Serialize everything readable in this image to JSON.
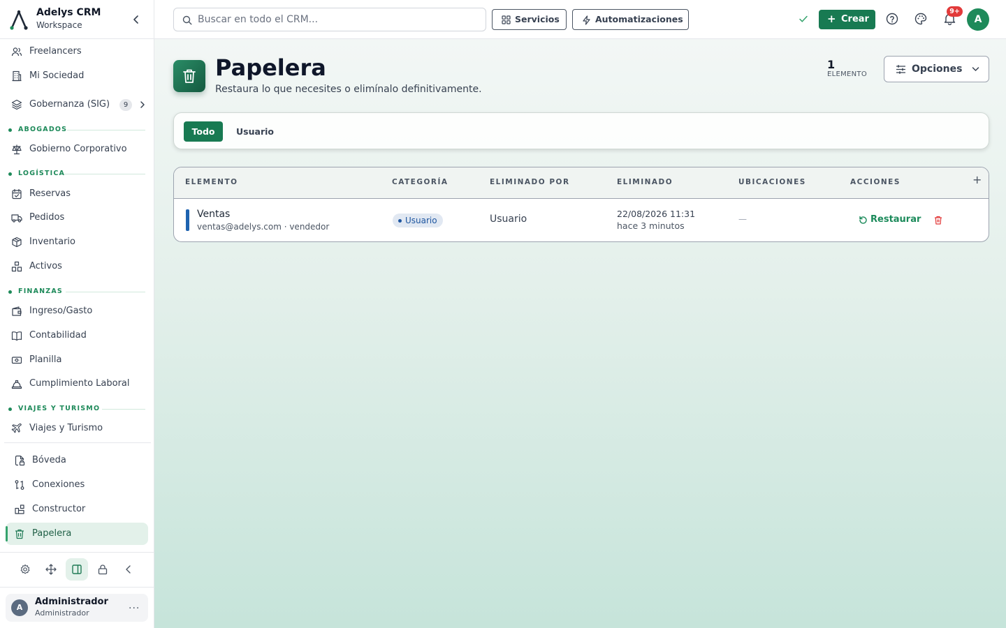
{
  "brand": {
    "name": "Adelys CRM",
    "workspace": "Workspace"
  },
  "sidebar": {
    "items": [
      {
        "label": "Freelancers"
      },
      {
        "label": "Mi Sociedad"
      },
      {
        "label": "Gobernanza (SIG)",
        "badge": "9"
      }
    ],
    "sections": [
      {
        "title": "ABOGADOS",
        "items": [
          {
            "label": "Gobierno Corporativo"
          }
        ]
      },
      {
        "title": "LOGÍSTICA",
        "items": [
          {
            "label": "Reservas"
          },
          {
            "label": "Pedidos"
          },
          {
            "label": "Inventario"
          },
          {
            "label": "Activos"
          }
        ]
      },
      {
        "title": "FINANZAS",
        "items": [
          {
            "label": "Ingreso/Gasto"
          },
          {
            "label": "Contabilidad"
          },
          {
            "label": "Planilla"
          },
          {
            "label": "Cumplimiento Laboral"
          }
        ]
      },
      {
        "title": "VIAJES Y TURISMO",
        "items": [
          {
            "label": "Viajes y Turismo"
          }
        ]
      }
    ],
    "bottom_items": [
      {
        "label": "Bóveda"
      },
      {
        "label": "Conexiones"
      },
      {
        "label": "Constructor"
      },
      {
        "label": "Papelera",
        "active": true
      }
    ]
  },
  "user": {
    "initial": "A",
    "name": "Administrador",
    "role": "Administrador",
    "more": "···"
  },
  "topbar": {
    "search_placeholder": "Buscar en todo el CRM...",
    "services_label": "Servicios",
    "automations_label": "Automatizaciones",
    "create_label": "Crear",
    "notifications_badge": "9+",
    "avatar_initial": "A"
  },
  "page": {
    "title": "Papelera",
    "subtitle": "Restaura lo que necesites o elimínalo definitivamente.",
    "count": "1",
    "count_label": "ELEMENTO",
    "options_label": "Opciones"
  },
  "filters": {
    "all": "Todo",
    "user": "Usuario"
  },
  "table": {
    "columns": [
      "ELEMENTO",
      "CATEGORÍA",
      "ELIMINADO POR",
      "ELIMINADO",
      "UBICACIONES",
      "ACCIONES"
    ],
    "add_column": "+",
    "rows": [
      {
        "name": "Ventas",
        "meta": "ventas@adelys.com · vendedor",
        "category": "Usuario",
        "deleted_by": "Usuario",
        "deleted_date": "22/08/2026 11:31",
        "deleted_ago": "hace 3 minutos",
        "locations": "—",
        "restore_label": "Restaurar"
      }
    ]
  },
  "colors": {
    "accent": "#187a52",
    "row_marker": "#1e63b0",
    "danger": "#e23a3a"
  }
}
